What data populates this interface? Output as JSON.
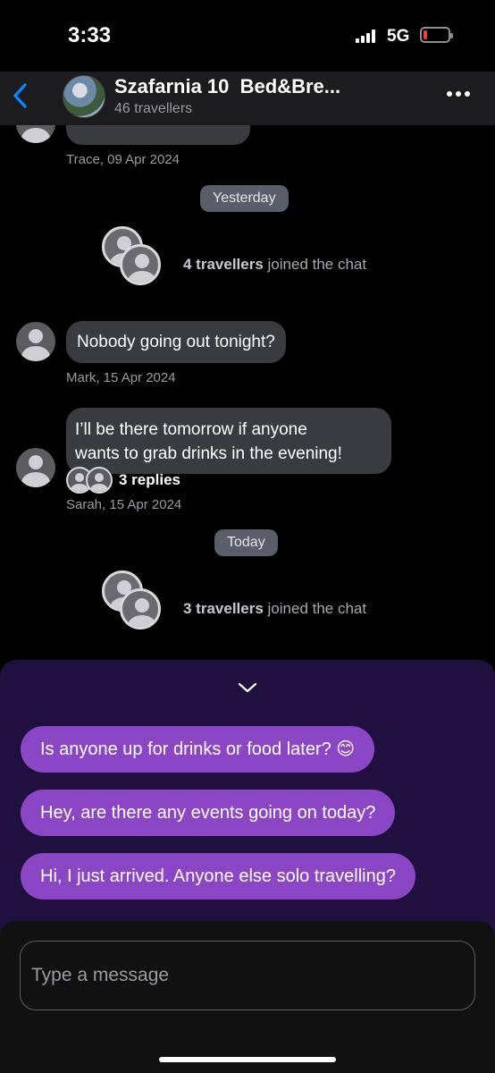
{
  "status_bar": {
    "time": "3:33",
    "network": "5G"
  },
  "header": {
    "title": "Szafarnia 10  Bed&Bre...",
    "subtitle": "46 travellers"
  },
  "chat": {
    "prev_message_meta": "Trace, 09 Apr 2024",
    "divider_yesterday": "Yesterday",
    "joined_1": {
      "count": "4 travellers",
      "text": "joined the chat"
    },
    "message_mark": {
      "text": "Nobody going out tonight?",
      "meta": "Mark, 15 Apr 2024"
    },
    "message_sarah": {
      "line1": "I’ll be there tomorrow if anyone",
      "line2": "wants to grab drinks in the evening!",
      "replies": "3 replies",
      "meta": "Sarah, 15 Apr 2024"
    },
    "divider_today": "Today",
    "joined_2": {
      "count": "3 travellers",
      "text": "joined the chat"
    }
  },
  "suggestions": [
    "Is anyone up for drinks or food later? 😊",
    "Hey, are there any events going on today?",
    "Hi, I just arrived. Anyone else solo travelling?"
  ],
  "composer": {
    "placeholder": "Type a message"
  },
  "colors": {
    "background": "#000000",
    "header": "#1c1c1e",
    "bubble": "#3a3b40",
    "suggestion": "#8a46c4",
    "panel": "#1f1040",
    "back_accent": "#0a84ff",
    "battery_low": "#ff3b30"
  },
  "icons": [
    "back-chevron-icon",
    "more-options-icon",
    "chevron-down-icon",
    "signal-icon",
    "battery-icon"
  ]
}
